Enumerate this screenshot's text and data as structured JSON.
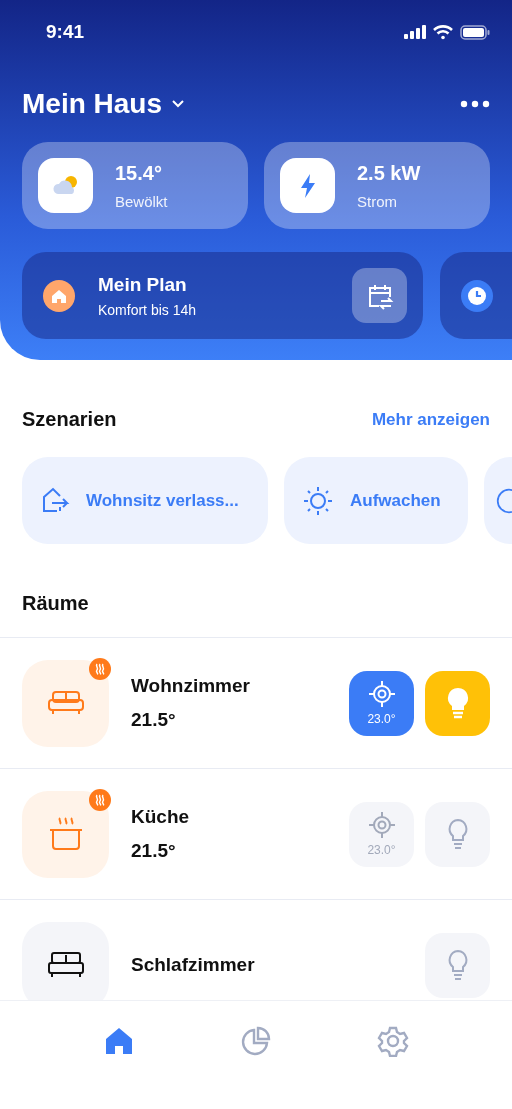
{
  "status_bar": {
    "time": "9:41"
  },
  "header": {
    "title": "Mein Haus"
  },
  "info_cards": [
    {
      "kind": "weather",
      "value": "15.4°",
      "label": "Bewölkt"
    },
    {
      "kind": "power",
      "value": "2.5 kW",
      "label": "Strom"
    }
  ],
  "plans": [
    {
      "kind": "schedule",
      "title": "Mein Plan",
      "subtitle": "Komfort bis 14h"
    },
    {
      "kind": "timer"
    }
  ],
  "scenes_section": {
    "title": "Szenarien",
    "link": "Mehr anzeigen"
  },
  "scenes": [
    {
      "kind": "leave",
      "label": "Wohnsitz verlass..."
    },
    {
      "kind": "wake",
      "label": "Aufwachen"
    },
    {
      "kind": "other"
    }
  ],
  "rooms_section": {
    "title": "Räume"
  },
  "rooms": [
    {
      "kind": "living",
      "name": "Wohnzimmer",
      "temperature": "21.5°",
      "heating": true,
      "thermostat": {
        "setpoint": "23.0°",
        "on": true
      },
      "light": {
        "on": true
      }
    },
    {
      "kind": "kitchen",
      "name": "Küche",
      "temperature": "21.5°",
      "heating": true,
      "thermostat": {
        "setpoint": "23.0°",
        "on": false
      },
      "light": {
        "on": false
      }
    },
    {
      "kind": "bedroom",
      "name": "Schlafzimmer",
      "heating": false,
      "light": {
        "on": false
      }
    }
  ],
  "nav": [
    {
      "kind": "home",
      "selected": true
    },
    {
      "kind": "stats",
      "selected": false
    },
    {
      "kind": "settings",
      "selected": false
    }
  ]
}
